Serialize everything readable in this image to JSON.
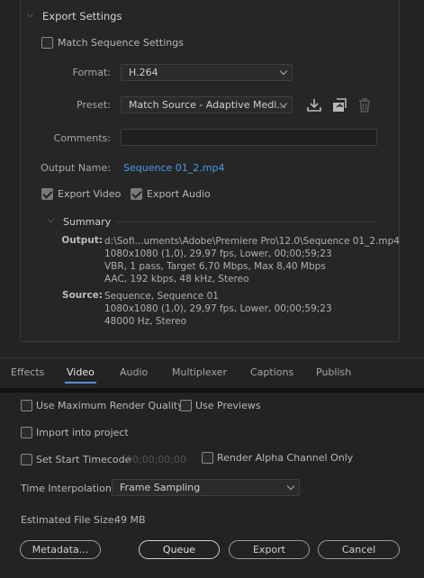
{
  "export_settings": {
    "title": "Export Settings",
    "match_sequence_label": "Match Sequence Settings",
    "match_sequence_checked": false,
    "format": {
      "label": "Format:",
      "value": "H.264"
    },
    "preset": {
      "label": "Preset:",
      "value": "Match Source - Adaptive Medi..."
    },
    "comments": {
      "label": "Comments:",
      "value": ""
    },
    "output_name": {
      "label": "Output Name:",
      "value": "Sequence 01_2.mp4"
    },
    "export_video": {
      "label": "Export Video",
      "checked": true
    },
    "export_audio": {
      "label": "Export Audio",
      "checked": true
    },
    "preset_icons": [
      "save-preset-icon",
      "import-preset-icon",
      "delete-preset-icon"
    ]
  },
  "summary": {
    "title": "Summary",
    "output_label": "Output:",
    "output_lines": [
      "d:\\Sofi...uments\\Adobe\\Premiere Pro\\12.0\\Sequence 01_2.mp4",
      "1080x1080 (1,0), 29,97 fps, Lower, 00;00;59;23",
      "VBR, 1 pass, Target 6,70 Mbps, Max 8,40 Mbps",
      "AAC, 192 kbps, 48 kHz, Stereo"
    ],
    "source_label": "Source:",
    "source_lines": [
      "Sequence, Sequence 01",
      "1080x1080 (1,0), 29,97 fps, Lower, 00;00;59;23",
      "48000 Hz, Stereo"
    ]
  },
  "tabs": {
    "items": [
      "Effects",
      "Video",
      "Audio",
      "Multiplexer",
      "Captions",
      "Publish"
    ],
    "active": "Video"
  },
  "options": {
    "max_render_quality": {
      "label": "Use Maximum Render Quality",
      "checked": false
    },
    "use_previews": {
      "label": "Use Previews",
      "checked": false
    },
    "import_into_project": {
      "label": "Import into project",
      "checked": false
    },
    "set_start_timecode": {
      "label": "Set Start Timecode",
      "checked": false,
      "value": "00;00;00;00"
    },
    "render_alpha": {
      "label": "Render Alpha Channel Only",
      "checked": false
    },
    "time_interpolation": {
      "label": "Time Interpolation:",
      "value": "Frame Sampling"
    },
    "estimated_size": {
      "label": "Estimated File Size:",
      "value": "49 MB"
    }
  },
  "buttons": {
    "metadata": "Metadata...",
    "queue": "Queue",
    "export": "Export",
    "cancel": "Cancel"
  },
  "colors": {
    "accent_link": "#4b9be8",
    "background": "#232323"
  }
}
